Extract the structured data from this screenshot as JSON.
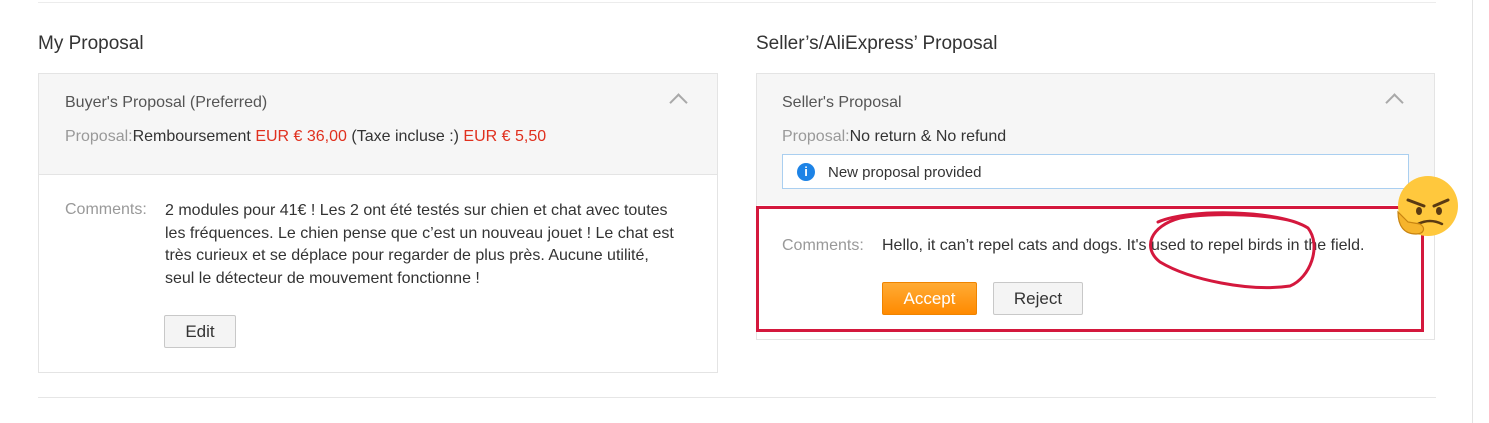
{
  "my_proposal": {
    "section_title": "My Proposal",
    "panel_title": "Buyer's Proposal (Preferred)",
    "proposal_label": "Proposal:",
    "proposal_text": "Remboursement ",
    "amount": "EUR € 36,00",
    "tax_text": " (Taxe incluse :) ",
    "tax_amount": "EUR € 5,50",
    "comments_label": "Comments:",
    "comments_lines": [
      "2 modules pour 41€ ! Les 2 ont été testés sur chien et chat avec toutes",
      "les fréquences. Le chien pense que c’est un nouveau jouet ! Le chat est",
      "très curieux et se déplace pour regarder de plus près. Aucune utilité,",
      "seul le détecteur de mouvement fonctionne !"
    ],
    "edit_label": "Edit"
  },
  "seller_proposal": {
    "section_title": "Seller’s/AliExpress’ Proposal",
    "panel_title": "Seller's Proposal",
    "proposal_label": "Proposal:",
    "proposal_text": "No return & No refund",
    "notice_text": "New proposal provided",
    "comments_label": "Comments:",
    "comment_text": "Hello, it can’t repel cats and dogs. It's used to repel birds in the field.",
    "accept_label": "Accept",
    "reject_label": "Reject"
  },
  "colors": {
    "accent_orange": "#ff9a1a",
    "amount_red": "#e0301e",
    "annotation_red": "#d4183d",
    "info_blue": "#1d83e6"
  },
  "icons": {
    "collapse": "chevron-up-icon",
    "info": "info-icon",
    "emoji": "thinking-angry-emoji-icon"
  }
}
